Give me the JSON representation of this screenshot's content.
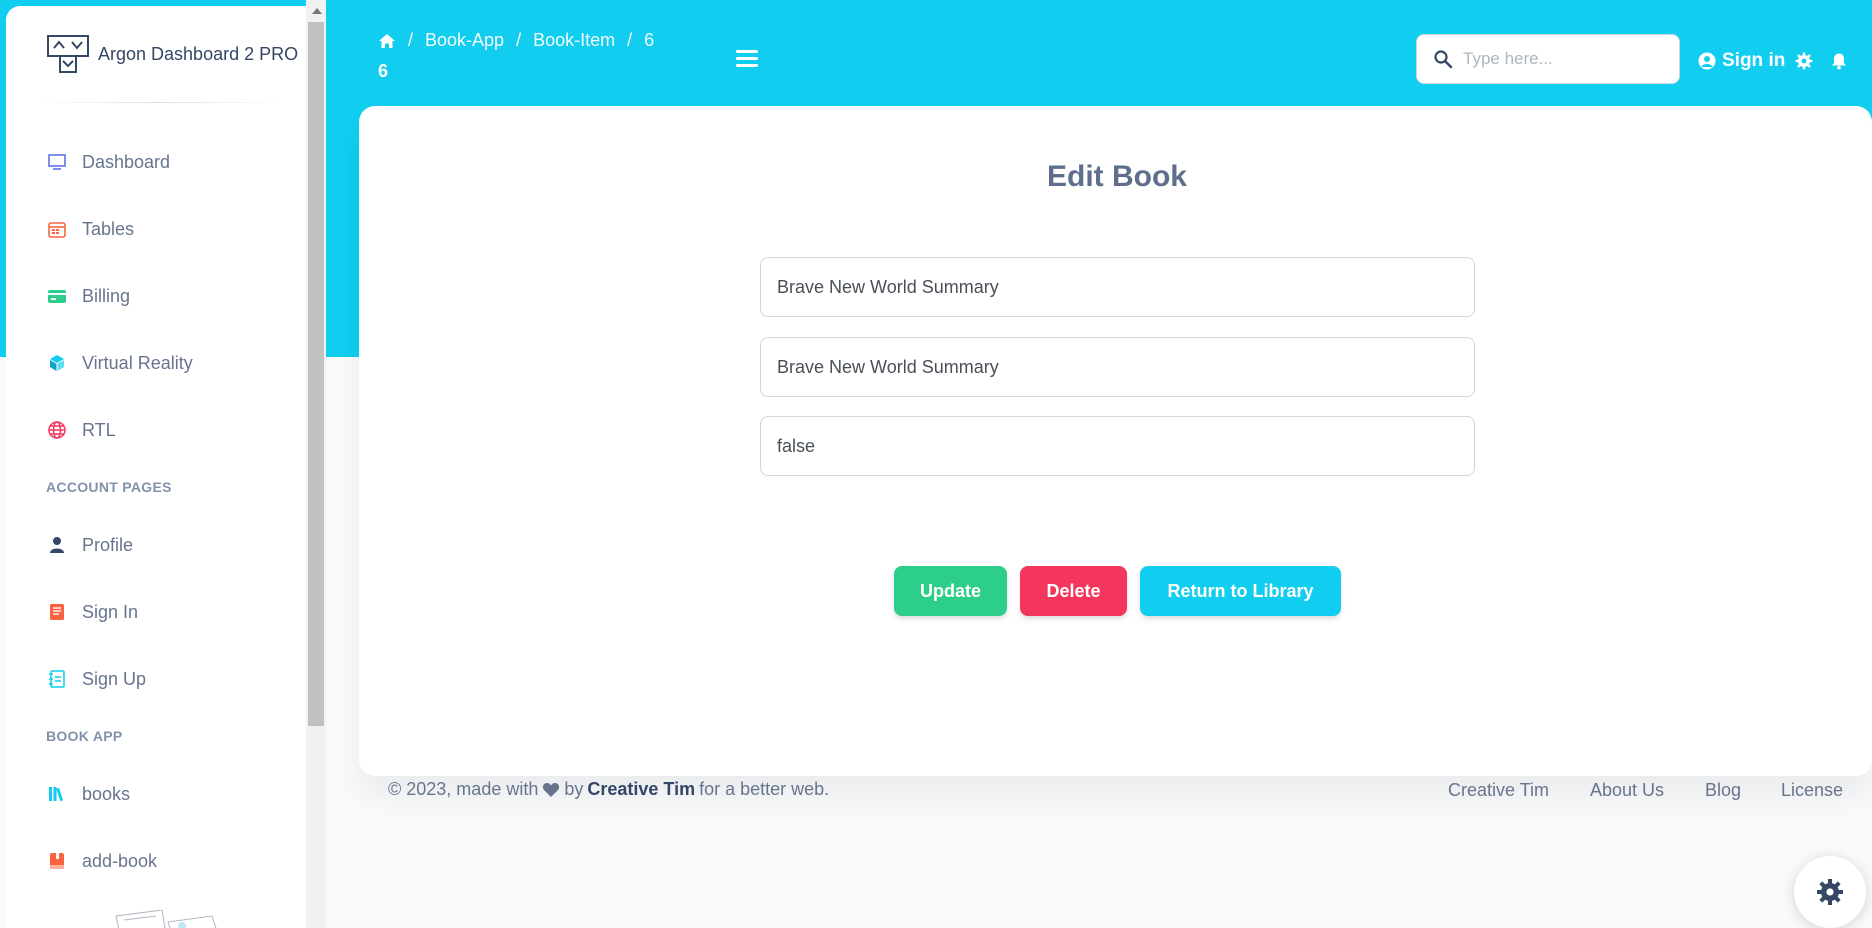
{
  "sidebar": {
    "brand": "Argon Dashboard 2 PRO",
    "items": [
      {
        "label": "Dashboard",
        "icon": "monitor-icon",
        "color": "#5e72e4"
      },
      {
        "label": "Tables",
        "icon": "calendar-icon",
        "color": "#fb6340"
      },
      {
        "label": "Billing",
        "icon": "credit-card-icon",
        "color": "#2dce89"
      },
      {
        "label": "Virtual Reality",
        "icon": "cube-icon",
        "color": "#11cdef"
      },
      {
        "label": "RTL",
        "icon": "globe-icon",
        "color": "#f5365c"
      }
    ],
    "account_section": "ACCOUNT PAGES",
    "account_items": [
      {
        "label": "Profile",
        "icon": "user-icon",
        "color": "#344767"
      },
      {
        "label": "Sign In",
        "icon": "document-icon",
        "color": "#fb6340"
      },
      {
        "label": "Sign Up",
        "icon": "collection-icon",
        "color": "#11cdef"
      }
    ],
    "book_section": "BOOK APP",
    "book_items": [
      {
        "label": "books",
        "icon": "books-icon",
        "color": "#11cdef"
      },
      {
        "label": "add-book",
        "icon": "book-icon",
        "color": "#fb6340"
      }
    ]
  },
  "header": {
    "breadcrumb": [
      "Book-App",
      "Book-Item",
      "6"
    ],
    "page_title": "6",
    "search_placeholder": "Type here...",
    "signin_label": "Sign in"
  },
  "form": {
    "title": "Edit Book",
    "field1": "Brave New World Summary",
    "field2": "Brave New World Summary",
    "field3": "false",
    "update_label": "Update",
    "delete_label": "Delete",
    "return_label": "Return to Library"
  },
  "footer": {
    "copyright_prefix": "© 2023, made with",
    "by": "by",
    "author": "Creative Tim",
    "suffix": "for a better web.",
    "links": [
      "Creative Tim",
      "About Us",
      "Blog",
      "License"
    ]
  },
  "colors": {
    "header_bg": "#11cdef",
    "update": "#2dce89",
    "delete": "#f5365c",
    "return": "#11cdef"
  }
}
